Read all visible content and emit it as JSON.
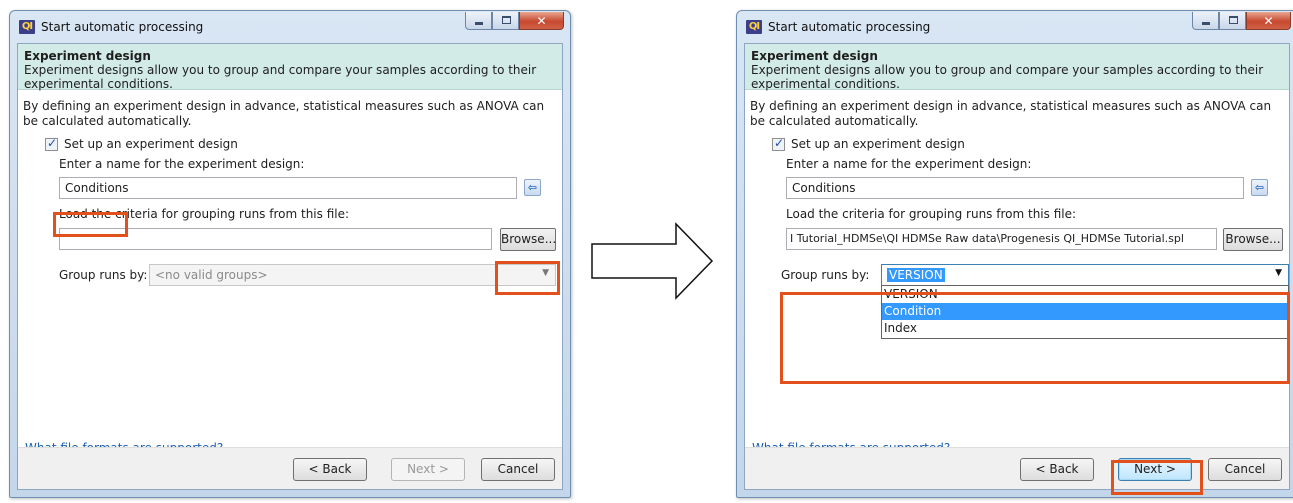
{
  "left_dialog": {
    "window_title": "Start automatic processing",
    "app_icon": "QI",
    "header_title": "Experiment design",
    "header_desc": "Experiment designs allow you to group and compare your samples according to their experimental conditions.",
    "intro": "By defining an experiment design in advance, statistical measures such as ANOVA can be calculated automatically.",
    "checkbox_label": "Set up an experiment design",
    "name_label": "Enter a name for the experiment design:",
    "name_value": "Conditions",
    "file_label": "Load the criteria for grouping runs from this file:",
    "file_value": "",
    "browse_label": "Browse...",
    "group_label": "Group runs by:",
    "group_value": "<no valid groups>",
    "link": "What file formats are supported?",
    "back": "< Back",
    "next": "Next >",
    "cancel": "Cancel"
  },
  "right_dialog": {
    "window_title": "Start automatic processing",
    "app_icon": "QI",
    "header_title": "Experiment design",
    "header_desc": "Experiment designs allow you to group and compare your samples according to their experimental conditions.",
    "intro": "By defining an experiment design in advance, statistical measures such as ANOVA can be calculated automatically.",
    "checkbox_label": "Set up an experiment design",
    "name_label": "Enter a name for the experiment design:",
    "name_value": "Conditions",
    "file_label": "Load the criteria for grouping runs from this file:",
    "file_value": "I Tutorial_HDMSe\\QI HDMSe Raw data\\Progenesis QI_HDMSe Tutorial.spl",
    "browse_label": "Browse...",
    "group_label": "Group runs by:",
    "group_value": "VERSION",
    "group_options": [
      "VERSION",
      "Condition",
      "Index"
    ],
    "group_highlighted": "Condition",
    "link": "What file formats are supported?",
    "back": "< Back",
    "next": "Next >",
    "cancel": "Cancel"
  },
  "colors": {
    "highlight_box": "#e2511b",
    "header_band": "#d3ebe6",
    "selection": "#3399ff",
    "link": "#1a5fb4"
  }
}
